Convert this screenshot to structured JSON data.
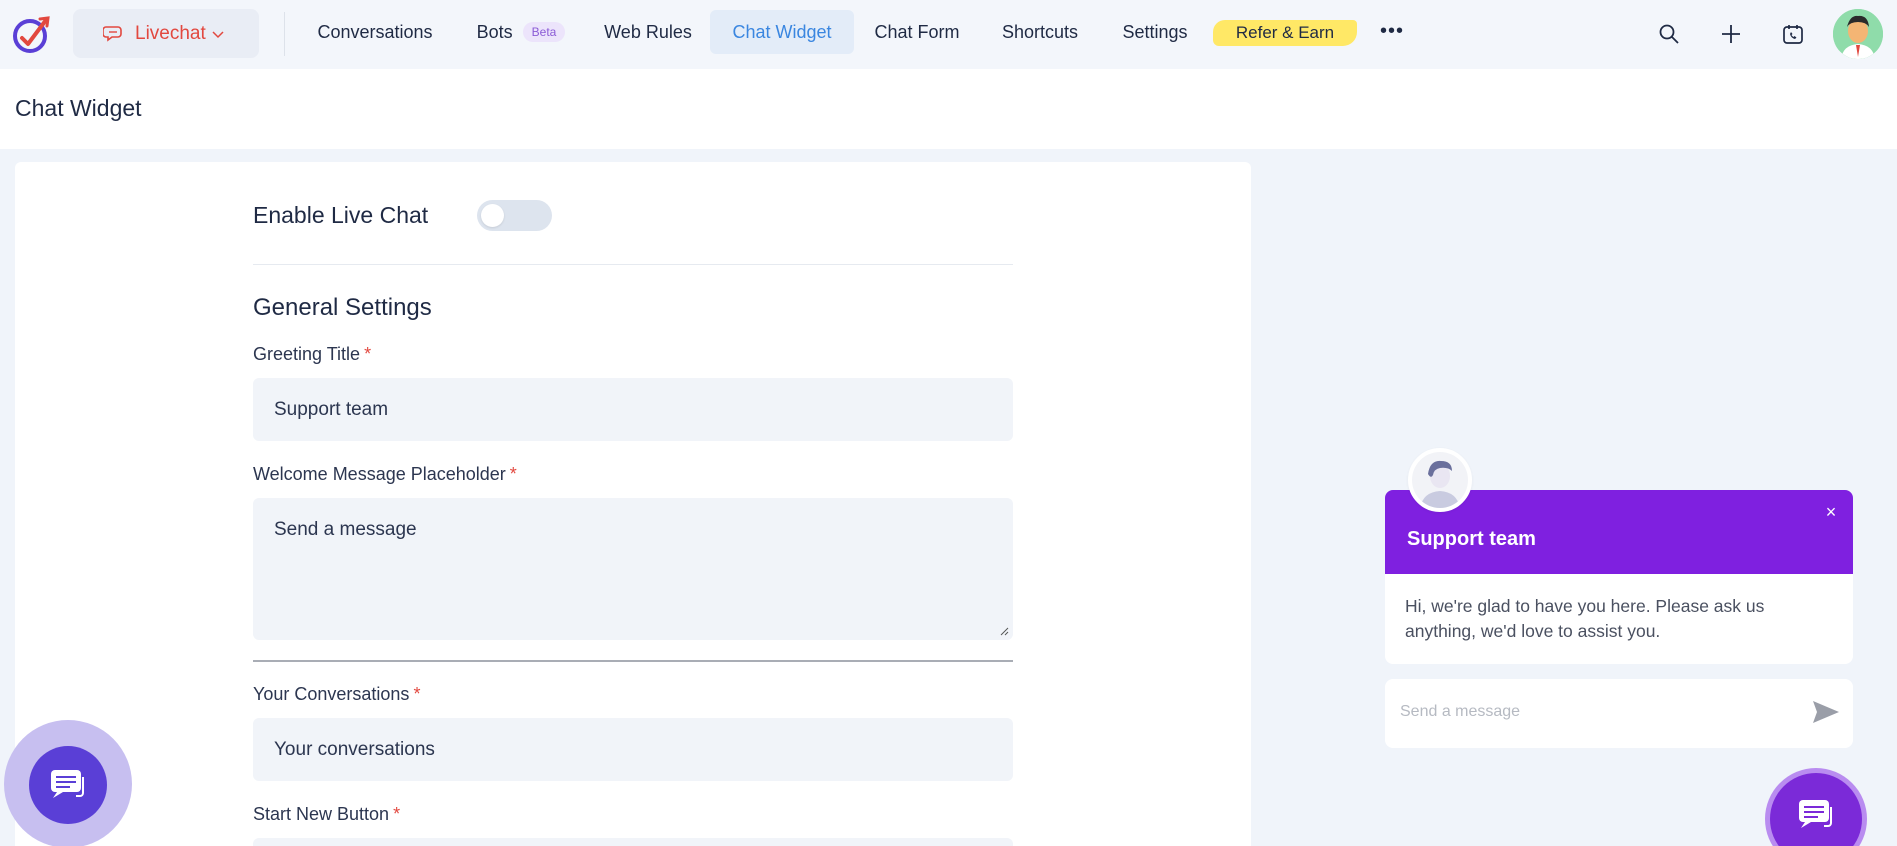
{
  "app_switcher": {
    "label": "Livechat",
    "icon": "chat-bubble-icon"
  },
  "nav": {
    "items": [
      {
        "label": "Conversations"
      },
      {
        "label": "Bots",
        "badge": "Beta"
      },
      {
        "label": "Web Rules"
      },
      {
        "label": "Chat Widget",
        "active": true
      },
      {
        "label": "Chat Form"
      },
      {
        "label": "Shortcuts"
      },
      {
        "label": "Settings"
      }
    ],
    "refer": "Refer & Earn",
    "more": "•••"
  },
  "header": {
    "title": "Chat Widget"
  },
  "form": {
    "enable_label": "Enable Live Chat",
    "enable_value": false,
    "section_title": "General Settings",
    "greeting_title": {
      "label": "Greeting Title",
      "required": "*",
      "value": "Support team"
    },
    "welcome_placeholder": {
      "label": "Welcome Message Placeholder",
      "required": "*",
      "value": "Send a message"
    },
    "your_conversations": {
      "label": "Your Conversations",
      "required": "*",
      "value": "Your conversations"
    },
    "start_new_button": {
      "label": "Start New Button",
      "required": "*"
    }
  },
  "preview": {
    "title": "Support team",
    "close": "×",
    "message": "Hi, we're glad to have you here. Please ask us anything, we'd love to assist you.",
    "input_placeholder": "Send a message"
  },
  "colors": {
    "accent_blue": "#3a86e0",
    "brand_red": "#e2483f",
    "widget_purple": "#7f20e0",
    "refer_yellow": "#ffe866"
  }
}
